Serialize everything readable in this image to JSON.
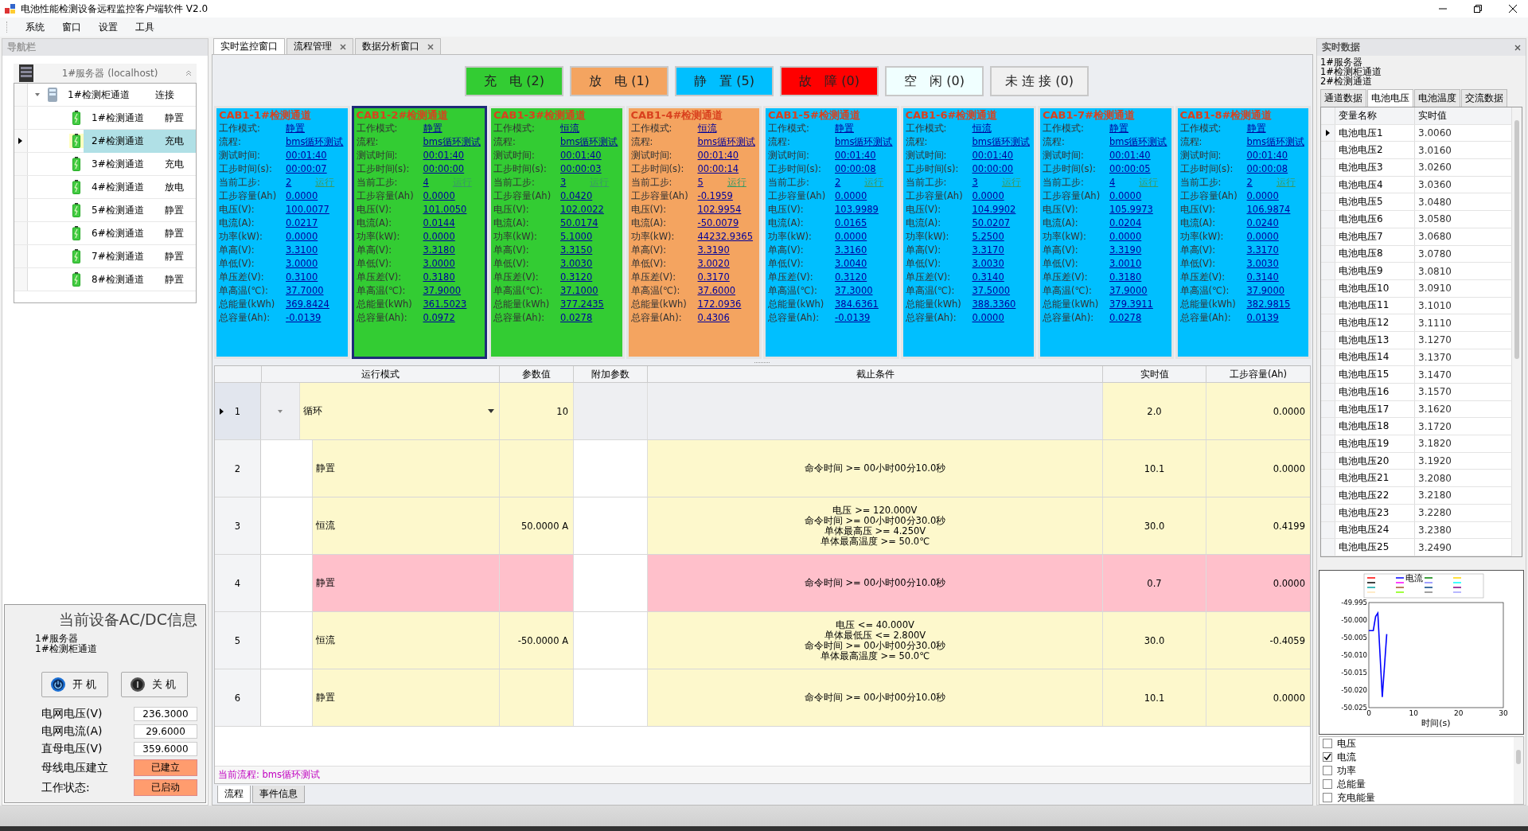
{
  "window": {
    "title": "电池性能检测设备远程监控客户端软件 V2.0"
  },
  "menu": [
    "系统",
    "窗口",
    "设置",
    "工具"
  ],
  "nav": {
    "title": "导航栏",
    "server": "1#服务器 (localhost)",
    "cabinet": {
      "name": "1#检测柜通道",
      "status": "连接",
      "expanded": true,
      "children": [
        {
          "name": "1#检测通道",
          "status": "静置",
          "selected": false
        },
        {
          "name": "2#检测通道",
          "status": "充电",
          "selected": true
        },
        {
          "name": "3#检测通道",
          "status": "充电",
          "selected": false
        },
        {
          "name": "4#检测通道",
          "status": "放电",
          "selected": false
        },
        {
          "name": "5#检测通道",
          "status": "静置",
          "selected": false
        },
        {
          "name": "6#检测通道",
          "status": "静置",
          "selected": false
        },
        {
          "name": "7#检测通道",
          "status": "静置",
          "selected": false
        },
        {
          "name": "8#检测通道",
          "status": "静置",
          "selected": false
        }
      ]
    }
  },
  "acdc": {
    "title": "当前设备AC/DC信息",
    "lines": [
      "1#服务器",
      "1#检测柜通道"
    ],
    "buttons": [
      {
        "kind": "on",
        "label": "开 机"
      },
      {
        "kind": "off",
        "label": "关 机"
      }
    ],
    "fields": [
      {
        "label": "电网电压(V)",
        "value": "236.3000",
        "kind": "text"
      },
      {
        "label": "电网电流(A)",
        "value": "29.6000",
        "kind": "text"
      },
      {
        "label": "直母电压(V)",
        "value": "359.6000",
        "kind": "text"
      },
      {
        "label": "母线电压建立",
        "value": "已建立",
        "kind": "flag"
      },
      {
        "label": "工作状态:",
        "value": "已启动",
        "kind": "flag"
      }
    ]
  },
  "tabs": [
    {
      "label": "实时监控窗口",
      "selected": true,
      "closable": false
    },
    {
      "label": "流程管理",
      "selected": false,
      "closable": true
    },
    {
      "label": "数据分析窗口",
      "selected": false,
      "closable": true
    }
  ],
  "status_buttons": [
    {
      "label": "充　电 (2)",
      "color": "#33cc33"
    },
    {
      "label": "放　电 (1)",
      "color": "#f4a460"
    },
    {
      "label": "静　置 (5)",
      "color": "#00bfff"
    },
    {
      "label": "故　障 (0)",
      "color": "#ff0000"
    },
    {
      "label": "空　闲 (0)",
      "color": "#f0ffff"
    },
    {
      "label": "未 连 接 (0)",
      "color": "#f0f0f0"
    }
  ],
  "cards": [
    {
      "title": "CAB1-1#检测通道",
      "color": "#00bfff",
      "selected": false,
      "fields": [
        {
          "label": "工作模式:",
          "value": "静置"
        },
        {
          "label": "流程:",
          "value": "bms循环测试"
        },
        {
          "label": "测试时间:",
          "value": "00:01:40"
        },
        {
          "label": "工步时间(s):",
          "value": "00:00:07"
        },
        {
          "label": "当前工步:",
          "value": "2",
          "status": "运行"
        },
        {
          "label": "工步容量(Ah)",
          "value": "0.0000"
        },
        {
          "label": "电压(V):",
          "value": "100.0077"
        },
        {
          "label": "电流(A):",
          "value": "0.0217"
        },
        {
          "label": "功率(kW):",
          "value": "0.0000"
        },
        {
          "label": "单高(V):",
          "value": "3.3100"
        },
        {
          "label": "单低(V):",
          "value": "3.0000"
        },
        {
          "label": "单压差(V):",
          "value": "0.3100"
        },
        {
          "label": "单高温(℃):",
          "value": "37.7000"
        },
        {
          "label": "总能量(kWh)",
          "value": "369.8424"
        },
        {
          "label": "总容量(Ah):",
          "value": "-0.0139"
        }
      ]
    },
    {
      "title": "CAB1-2#检测通道",
      "color": "#33cc33",
      "selected": true,
      "fields": [
        {
          "label": "工作模式:",
          "value": "静置"
        },
        {
          "label": "流程:",
          "value": "bms循环测试"
        },
        {
          "label": "测试时间:",
          "value": "00:01:40"
        },
        {
          "label": "工步时间(s):",
          "value": "00:00:00"
        },
        {
          "label": "当前工步:",
          "value": "4",
          "status": "运行"
        },
        {
          "label": "工步容量(Ah)",
          "value": "0.0000"
        },
        {
          "label": "电压(V):",
          "value": "101.0050"
        },
        {
          "label": "电流(A):",
          "value": "0.0144"
        },
        {
          "label": "功率(kW):",
          "value": "0.0000"
        },
        {
          "label": "单高(V):",
          "value": "3.3180"
        },
        {
          "label": "单低(V):",
          "value": "3.0000"
        },
        {
          "label": "单压差(V):",
          "value": "0.3180"
        },
        {
          "label": "单高温(℃):",
          "value": "37.9000"
        },
        {
          "label": "总能量(kWh)",
          "value": "361.5023"
        },
        {
          "label": "总容量(Ah):",
          "value": "0.0972"
        }
      ]
    },
    {
      "title": "CAB1-3#检测通道",
      "color": "#33cc33",
      "selected": false,
      "fields": [
        {
          "label": "工作模式:",
          "value": "恒流"
        },
        {
          "label": "流程:",
          "value": "bms循环测试"
        },
        {
          "label": "测试时间:",
          "value": "00:01:40"
        },
        {
          "label": "工步时间(s):",
          "value": "00:00:03"
        },
        {
          "label": "当前工步:",
          "value": "3",
          "status": "运行"
        },
        {
          "label": "工步容量(Ah)",
          "value": "0.0420"
        },
        {
          "label": "电压(V):",
          "value": "102.0022"
        },
        {
          "label": "电流(A):",
          "value": "50.0174"
        },
        {
          "label": "功率(kW):",
          "value": "5.1000"
        },
        {
          "label": "单高(V):",
          "value": "3.3150"
        },
        {
          "label": "单低(V):",
          "value": "3.0030"
        },
        {
          "label": "单压差(V):",
          "value": "0.3120"
        },
        {
          "label": "单高温(℃):",
          "value": "37.1000"
        },
        {
          "label": "总能量(kWh)",
          "value": "377.2435"
        },
        {
          "label": "总容量(Ah):",
          "value": "0.0278"
        }
      ]
    },
    {
      "title": "CAB1-4#检测通道",
      "color": "#f4a460",
      "selected": false,
      "fields": [
        {
          "label": "工作模式:",
          "value": "恒流"
        },
        {
          "label": "流程:",
          "value": "bms循环测试"
        },
        {
          "label": "测试时间:",
          "value": "00:01:40"
        },
        {
          "label": "工步时间(s):",
          "value": "00:00:14"
        },
        {
          "label": "当前工步:",
          "value": "5",
          "status": "运行"
        },
        {
          "label": "工步容量(Ah)",
          "value": "-0.1959"
        },
        {
          "label": "电压(V):",
          "value": "102.9954"
        },
        {
          "label": "电流(A):",
          "value": "-50.0079"
        },
        {
          "label": "功率(kW):",
          "value": "44232.9365"
        },
        {
          "label": "单高(V):",
          "value": "3.3190"
        },
        {
          "label": "单低(V):",
          "value": "3.0020"
        },
        {
          "label": "单压差(V):",
          "value": "0.3170"
        },
        {
          "label": "单高温(℃):",
          "value": "37.6000"
        },
        {
          "label": "总能量(kWh)",
          "value": "172.0936"
        },
        {
          "label": "总容量(Ah):",
          "value": "0.4306"
        }
      ]
    },
    {
      "title": "CAB1-5#检测通道",
      "color": "#00bfff",
      "selected": false,
      "fields": [
        {
          "label": "工作模式:",
          "value": "静置"
        },
        {
          "label": "流程:",
          "value": "bms循环测试"
        },
        {
          "label": "测试时间:",
          "value": "00:01:40"
        },
        {
          "label": "工步时间(s):",
          "value": "00:00:08"
        },
        {
          "label": "当前工步:",
          "value": "2",
          "status": "运行"
        },
        {
          "label": "工步容量(Ah)",
          "value": "0.0000"
        },
        {
          "label": "电压(V):",
          "value": "103.9989"
        },
        {
          "label": "电流(A):",
          "value": "0.0165"
        },
        {
          "label": "功率(kW):",
          "value": "0.0000"
        },
        {
          "label": "单高(V):",
          "value": "3.3160"
        },
        {
          "label": "单低(V):",
          "value": "3.0040"
        },
        {
          "label": "单压差(V):",
          "value": "0.3120"
        },
        {
          "label": "单高温(℃):",
          "value": "37.3000"
        },
        {
          "label": "总能量(kWh)",
          "value": "384.6361"
        },
        {
          "label": "总容量(Ah):",
          "value": "-0.0139"
        }
      ]
    },
    {
      "title": "CAB1-6#检测通道",
      "color": "#00bfff",
      "selected": false,
      "fields": [
        {
          "label": "工作模式:",
          "value": "恒流"
        },
        {
          "label": "流程:",
          "value": "bms循环测试"
        },
        {
          "label": "测试时间:",
          "value": "00:01:40"
        },
        {
          "label": "工步时间(s):",
          "value": "00:00:00"
        },
        {
          "label": "当前工步:",
          "value": "3",
          "status": "运行"
        },
        {
          "label": "工步容量(Ah)",
          "value": "0.0000"
        },
        {
          "label": "电压(V):",
          "value": "104.9902"
        },
        {
          "label": "电流(A):",
          "value": "50.0207"
        },
        {
          "label": "功率(kW):",
          "value": "5.2500"
        },
        {
          "label": "单高(V):",
          "value": "3.3170"
        },
        {
          "label": "单低(V):",
          "value": "3.0030"
        },
        {
          "label": "单压差(V):",
          "value": "0.3140"
        },
        {
          "label": "单高温(℃):",
          "value": "37.5000"
        },
        {
          "label": "总能量(kWh)",
          "value": "388.3360"
        },
        {
          "label": "总容量(Ah):",
          "value": "0.0000"
        }
      ]
    },
    {
      "title": "CAB1-7#检测通道",
      "color": "#00bfff",
      "selected": false,
      "fields": [
        {
          "label": "工作模式:",
          "value": "静置"
        },
        {
          "label": "流程:",
          "value": "bms循环测试"
        },
        {
          "label": "测试时间:",
          "value": "00:01:40"
        },
        {
          "label": "工步时间(s):",
          "value": "00:00:05"
        },
        {
          "label": "当前工步:",
          "value": "4",
          "status": "运行"
        },
        {
          "label": "工步容量(Ah)",
          "value": "0.0000"
        },
        {
          "label": "电压(V):",
          "value": "105.9973"
        },
        {
          "label": "电流(A):",
          "value": "0.0204"
        },
        {
          "label": "功率(kW):",
          "value": "0.0000"
        },
        {
          "label": "单高(V):",
          "value": "3.3190"
        },
        {
          "label": "单低(V):",
          "value": "3.0010"
        },
        {
          "label": "单压差(V):",
          "value": "0.3180"
        },
        {
          "label": "单高温(℃):",
          "value": "37.9000"
        },
        {
          "label": "总能量(kWh)",
          "value": "379.3911"
        },
        {
          "label": "总容量(Ah):",
          "value": "0.0278"
        }
      ]
    },
    {
      "title": "CAB1-8#检测通道",
      "color": "#00bfff",
      "selected": false,
      "fields": [
        {
          "label": "工作模式:",
          "value": "静置"
        },
        {
          "label": "流程:",
          "value": "bms循环测试"
        },
        {
          "label": "测试时间:",
          "value": "00:01:40"
        },
        {
          "label": "工步时间(s):",
          "value": "00:00:08"
        },
        {
          "label": "当前工步:",
          "value": "2",
          "status": "运行"
        },
        {
          "label": "工步容量(Ah)",
          "value": "0.0000"
        },
        {
          "label": "电压(V):",
          "value": "106.9874"
        },
        {
          "label": "电流(A):",
          "value": "0.0240"
        },
        {
          "label": "功率(kW):",
          "value": "0.0000"
        },
        {
          "label": "单高(V):",
          "value": "3.3170"
        },
        {
          "label": "单低(V):",
          "value": "3.0030"
        },
        {
          "label": "单压差(V):",
          "value": "0.3140"
        },
        {
          "label": "单高温(℃):",
          "value": "37.9000"
        },
        {
          "label": "总能量(kWh)",
          "value": "382.9815"
        },
        {
          "label": "总容量(Ah):",
          "value": "0.0139"
        }
      ]
    }
  ],
  "steps": {
    "columns": [
      "运行模式",
      "参数值",
      "附加参数",
      "截止条件",
      "实时值",
      "工步容量(Ah)"
    ],
    "rows": [
      {
        "index": "1",
        "kind": "loop",
        "selected": true,
        "running": false,
        "mode": "循环",
        "param": "10",
        "condition": [],
        "realtime": "2.0",
        "capacity": "0.0000"
      },
      {
        "index": "2",
        "kind": "step",
        "selected": false,
        "running": false,
        "mode": "静置",
        "param": "",
        "condition": [
          "命令时间 >= 00小时00分10.0秒"
        ],
        "realtime": "10.1",
        "capacity": "0.0000"
      },
      {
        "index": "3",
        "kind": "step",
        "selected": false,
        "running": false,
        "mode": "恒流",
        "param": "50.0000 A",
        "condition": [
          "电压 >= 120.000V",
          "命令时间 >= 00小时00分30.0秒",
          "单体最高压 >= 4.250V",
          "单体最高温度 >= 50.0℃"
        ],
        "realtime": "30.0",
        "capacity": "0.4199"
      },
      {
        "index": "4",
        "kind": "step",
        "selected": false,
        "running": true,
        "mode": "静置",
        "param": "",
        "condition": [
          "命令时间 >= 00小时00分10.0秒"
        ],
        "realtime": "0.7",
        "capacity": "0.0000"
      },
      {
        "index": "5",
        "kind": "step",
        "selected": false,
        "running": false,
        "mode": "恒流",
        "param": "-50.0000 A",
        "condition": [
          "电压 <= 40.000V",
          "单体最低压 <= 2.800V",
          "命令时间 >= 00小时00分30.0秒",
          "单体最高温度 >= 50.0℃"
        ],
        "realtime": "30.0",
        "capacity": "-0.4059"
      },
      {
        "index": "6",
        "kind": "step",
        "selected": false,
        "running": false,
        "mode": "静置",
        "param": "",
        "condition": [
          "命令时间 >= 00小时00分10.0秒"
        ],
        "realtime": "10.1",
        "capacity": "0.0000"
      }
    ],
    "current_flow": "当前流程:  bms循环测试"
  },
  "bottom_tabs": [
    {
      "label": "流程",
      "selected": true
    },
    {
      "label": "事件信息",
      "selected": false
    }
  ],
  "realtime": {
    "title": "实时数据",
    "lines": [
      "1#服务器",
      "1#检测柜通道",
      "2#检测通道"
    ],
    "tabs": [
      {
        "label": "通道数据",
        "selected": false
      },
      {
        "label": "电池电压",
        "selected": true
      },
      {
        "label": "电池温度",
        "selected": false
      },
      {
        "label": "交流数据",
        "selected": false
      }
    ],
    "columns": [
      "变量名称",
      "实时值"
    ],
    "rows": [
      {
        "name": "电池电压1",
        "value": "3.0060",
        "selected": true
      },
      {
        "name": "电池电压2",
        "value": "3.0160",
        "selected": false
      },
      {
        "name": "电池电压3",
        "value": "3.0260",
        "selected": false
      },
      {
        "name": "电池电压4",
        "value": "3.0360",
        "selected": false
      },
      {
        "name": "电池电压5",
        "value": "3.0480",
        "selected": false
      },
      {
        "name": "电池电压6",
        "value": "3.0580",
        "selected": false
      },
      {
        "name": "电池电压7",
        "value": "3.0680",
        "selected": false
      },
      {
        "name": "电池电压8",
        "value": "3.0780",
        "selected": false
      },
      {
        "name": "电池电压9",
        "value": "3.0810",
        "selected": false
      },
      {
        "name": "电池电压10",
        "value": "3.0910",
        "selected": false
      },
      {
        "name": "电池电压11",
        "value": "3.1010",
        "selected": false
      },
      {
        "name": "电池电压12",
        "value": "3.1110",
        "selected": false
      },
      {
        "name": "电池电压13",
        "value": "3.1270",
        "selected": false
      },
      {
        "name": "电池电压14",
        "value": "3.1370",
        "selected": false
      },
      {
        "name": "电池电压15",
        "value": "3.1470",
        "selected": false
      },
      {
        "name": "电池电压16",
        "value": "3.1570",
        "selected": false
      },
      {
        "name": "电池电压17",
        "value": "3.1620",
        "selected": false
      },
      {
        "name": "电池电压18",
        "value": "3.1720",
        "selected": false
      },
      {
        "name": "电池电压19",
        "value": "3.1820",
        "selected": false
      },
      {
        "name": "电池电压20",
        "value": "3.1920",
        "selected": false
      },
      {
        "name": "电池电压21",
        "value": "3.2080",
        "selected": false
      },
      {
        "name": "电池电压22",
        "value": "3.2180",
        "selected": false
      },
      {
        "name": "电池电压23",
        "value": "3.2280",
        "selected": false
      },
      {
        "name": "电池电压24",
        "value": "3.2380",
        "selected": false
      },
      {
        "name": "电池电压25",
        "value": "3.2490",
        "selected": false
      }
    ],
    "chart_data": {
      "type": "line",
      "xlabel": "时间(s)",
      "x": [
        0,
        1,
        1.5,
        2,
        2.5,
        3,
        3.5,
        4
      ],
      "series": [
        {
          "name": "电流",
          "color": "#0000ff",
          "values": [
            -50.003,
            -50.003,
            -49.999,
            -49.998,
            -50.01,
            -50.022,
            -50.013,
            -50.004
          ]
        }
      ],
      "xlim": [
        0,
        30
      ],
      "ylim": [
        -50.025,
        -49.995
      ],
      "xticks": [
        0,
        10,
        20,
        30
      ],
      "yticks": [
        {
          "value": -49.995,
          "label": "-49.995"
        },
        {
          "value": -50.0,
          "label": "-50.000"
        },
        {
          "value": -50.005,
          "label": "-50.005"
        },
        {
          "value": -50.01,
          "label": "-50.010"
        },
        {
          "value": -50.015,
          "label": "-50.015"
        },
        {
          "value": -50.02,
          "label": "-50.020"
        },
        {
          "value": -50.025,
          "label": "-50.025"
        }
      ]
    },
    "checks": [
      {
        "label": "电压",
        "checked": false
      },
      {
        "label": "电流",
        "checked": true
      },
      {
        "label": "功率",
        "checked": false
      },
      {
        "label": "总能量",
        "checked": false
      },
      {
        "label": "充电能量",
        "checked": false
      }
    ]
  }
}
